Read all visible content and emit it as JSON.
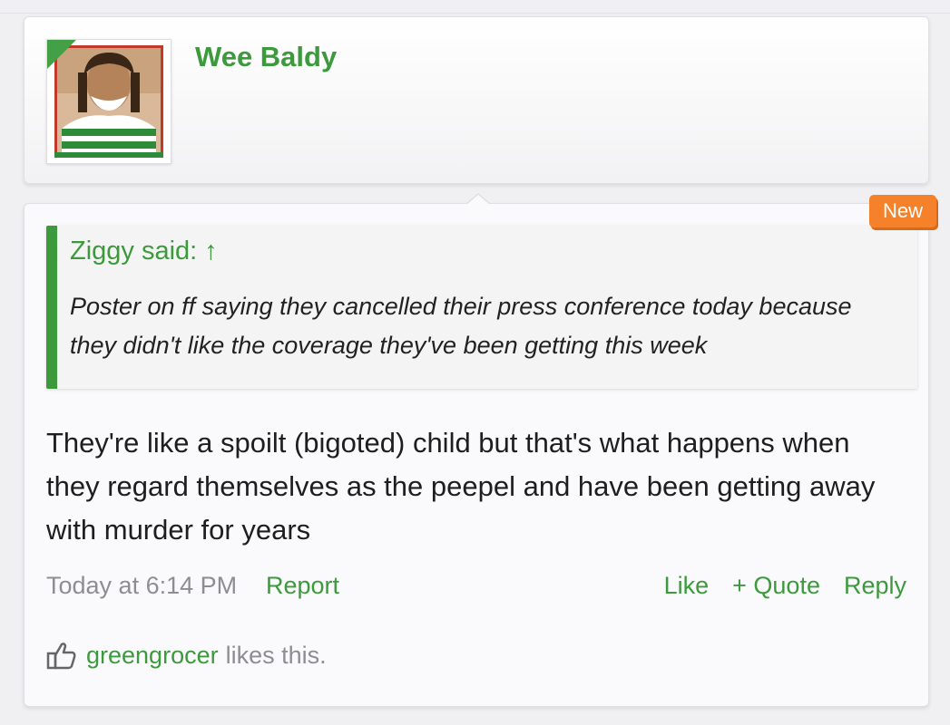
{
  "user": {
    "name": "Wee Baldy",
    "avatar_icon": "user-avatar-photo"
  },
  "post": {
    "badge": "New",
    "quote": {
      "author_line": "Ziggy said: ↑",
      "text": "Poster on ff saying they cancelled their press conference today because they didn't like the coverage they've been getting this week"
    },
    "message": "They're like a spoilt (bigoted) child but that's what happens when they regard themselves as the peepel and have been getting away with murder for years",
    "timestamp": "Today at 6:14 PM",
    "report_label": "Report",
    "actions": {
      "like": "Like",
      "quote": "+ Quote",
      "reply": "Reply"
    },
    "likes": {
      "icon": "thumbs-up-icon",
      "user": "greengrocer",
      "suffix": "likes this."
    }
  },
  "colors": {
    "accent_green": "#3c9a3c",
    "badge_orange": "#f5822a",
    "muted_text": "#8e8e92"
  }
}
